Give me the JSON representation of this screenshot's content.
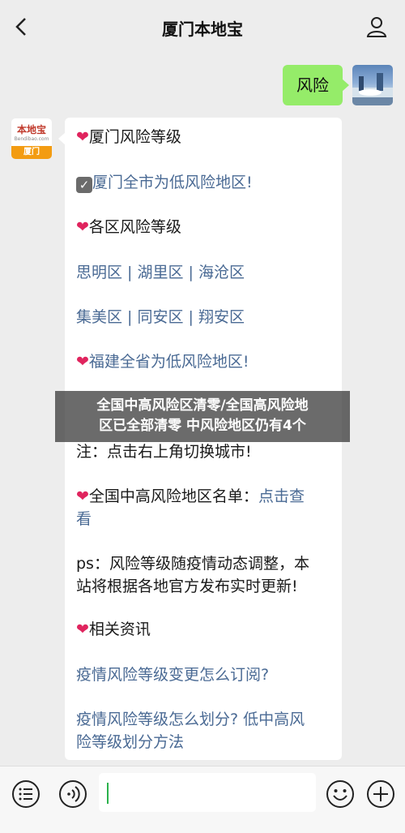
{
  "header": {
    "title": "厦门本地宝"
  },
  "user_message": {
    "text": "风险"
  },
  "bot": {
    "logo_name": "本地宝",
    "logo_url": "Bendibao.com",
    "logo_city": "厦门",
    "lines": {
      "l1": "厦门风险等级",
      "l2": "厦门全市为低风险地区!",
      "l3": "各区风险等级",
      "l4": "思明区 | 湖里区 | 海沧区",
      "l5": "集美区 | 同安区 | 翔安区",
      "l6": "福建全省为低风险地区!",
      "l7": "注：点击右上角切换城市!",
      "l8a": "全国中高风险地区名单：",
      "l8b": "点击查",
      "l8c": "看",
      "l9a": "ps：风险等级随疫情动态调整，本",
      "l9b": "站将根据各地官方发布实时更新!",
      "l10": "相关资讯",
      "l11": "疫情风险等级变更怎么订阅?",
      "l12a": "疫情风险等级怎么划分? 低中高风",
      "l12b": "险等级划分方法"
    }
  },
  "overlay": {
    "line1": "全国中高风险区清零/全国高风险地",
    "line2": "区已全部清零 中风险地区仍有4个"
  },
  "colors": {
    "user_bubble": "#95ec69",
    "link": "#4a6a94",
    "heart": "#e0245e"
  }
}
